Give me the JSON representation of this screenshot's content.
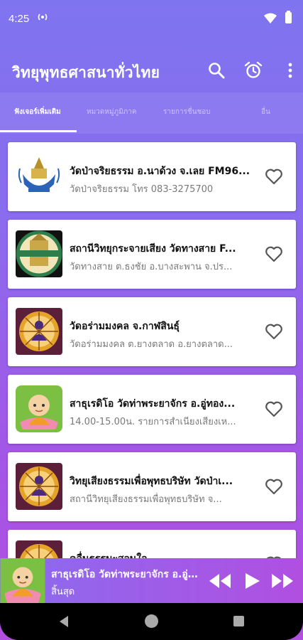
{
  "status_bar": {
    "time": "4:25"
  },
  "app_bar": {
    "title": "วิทยุพุทธศาสนาทั่วไทย"
  },
  "tabs": [
    {
      "label": "ฟังเจอร์เพิ่มเติม"
    },
    {
      "label": "หมวดหมู่ภูมิภาค"
    },
    {
      "label": "รายการชื่นชอบ"
    },
    {
      "label": "อื่น"
    }
  ],
  "stations": [
    {
      "title": "วัดป่าจริยธรรม อ.นาด้วง จ.เลย FM96...",
      "subtitle": "วัดป่าจริยธรรม โทร 083-3275700",
      "thumb_icon": "wat-emblem-icon"
    },
    {
      "title": "สถานีวิทยุกระจายเสียง วัดทางสาย F...",
      "subtitle": "วัดทางสาย ต.ธงชัย อ.บางสะพาน จ.ปร...",
      "thumb_icon": "wat-tangsai-logo-icon"
    },
    {
      "title": "วัดอร่ามมงคล จ.กาฬสินธุ์",
      "subtitle": "วัดอร่ามมงคล ต.ยางตลาด อ.ยางตลาด...",
      "thumb_icon": "dharma-wheel-buddha-icon"
    },
    {
      "title": "สาธุเรดิโอ วัดท่าพระยาจักร อ.อู่ทอง...",
      "subtitle": "14.00-15.00น. รายการสำเนียงเสียงเห...",
      "thumb_icon": "monk-cartoon-icon"
    },
    {
      "title": "วิทยุเสียงธรรมเพื่อพุทธบริษัท วัดป่าเ...",
      "subtitle": "สถานีวิทยุเสียงธรรมเพื่อพุทธบริษัท จ...",
      "thumb_icon": "dharma-wheel-buddha-icon"
    },
    {
      "title": "คลื่นธรรมะสอนใจ",
      "subtitle": "",
      "thumb_icon": "dharma-wheel-buddha-icon"
    }
  ],
  "mini_player": {
    "title": "สาธุเรดิโอ วัดท่าพระยาจักร อ.อู่ทอง...",
    "status": "สิ้นสุด",
    "thumb_icon": "monk-cartoon-icon"
  },
  "colors": {
    "gradient_top": "#7f74f0",
    "gradient_bottom": "#b24ee0",
    "card": "#ffffff"
  }
}
